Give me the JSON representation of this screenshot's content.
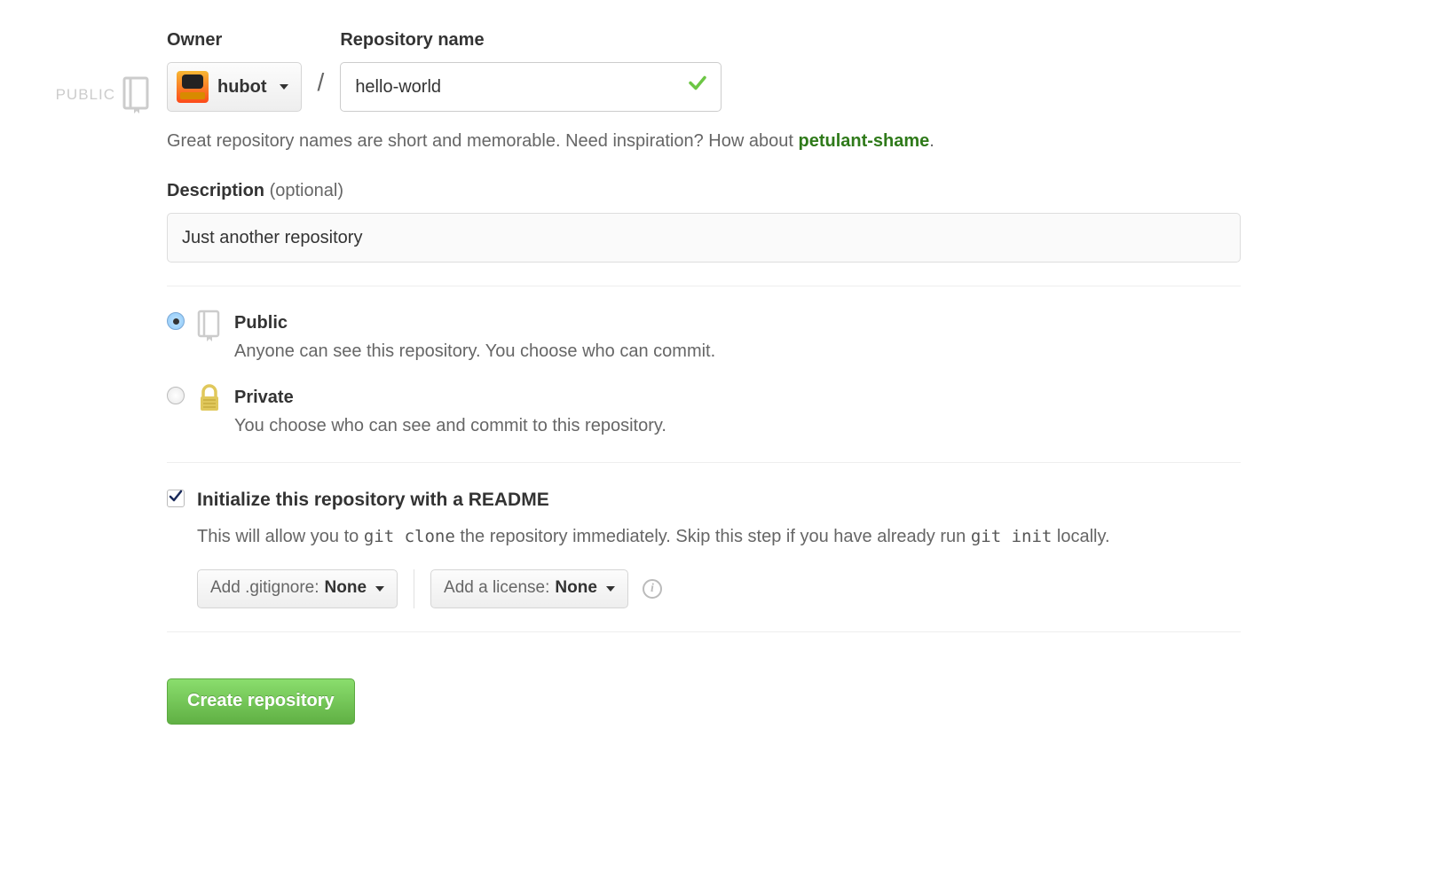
{
  "sidebar": {
    "public_badge": "PUBLIC"
  },
  "owner": {
    "label": "Owner",
    "name": "hubot"
  },
  "repo_name": {
    "label": "Repository name",
    "value": "hello-world"
  },
  "slash": "/",
  "hint": {
    "prefix": "Great repository names are short and memorable. Need inspiration? How about ",
    "suggestion": "petulant-shame",
    "suffix": "."
  },
  "description": {
    "label": "Description",
    "optional": "(optional)",
    "value": "Just another repository"
  },
  "visibility": {
    "public": {
      "title": "Public",
      "desc": "Anyone can see this repository. You choose who can commit."
    },
    "private": {
      "title": "Private",
      "desc": "You choose who can see and commit to this repository."
    }
  },
  "readme": {
    "title": "Initialize this repository with a README",
    "desc_before": "This will allow you to ",
    "clone_code": "git clone",
    "desc_middle": " the repository immediately. Skip this step if you have already run ",
    "init_code": "git init",
    "desc_after": " locally."
  },
  "gitignore": {
    "label": "Add .gitignore: ",
    "value": "None"
  },
  "license": {
    "label": "Add a license: ",
    "value": "None"
  },
  "info_glyph": "i",
  "create_button": "Create repository"
}
